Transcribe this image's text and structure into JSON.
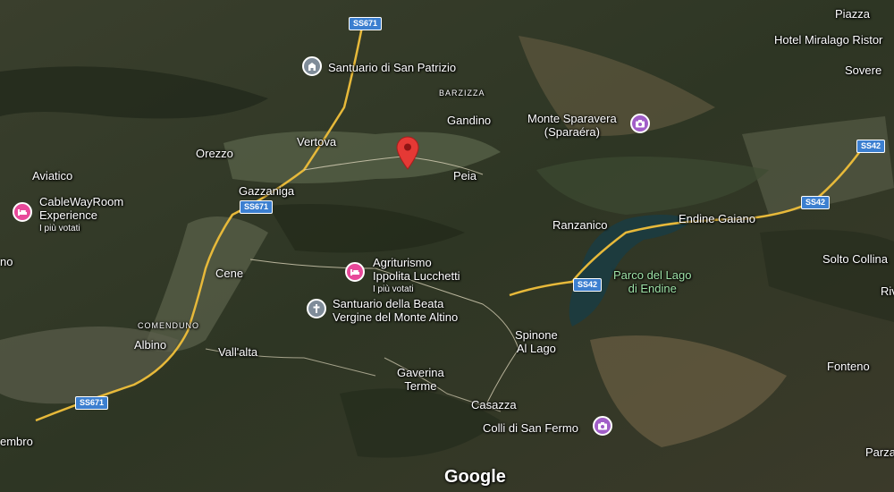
{
  "map": {
    "places": {
      "piazza": "Piazza",
      "hotel": "Hotel Miralago Ristor",
      "sovere": "Sovere",
      "barzizza": "BARZIZZA",
      "gandino": "Gandino",
      "vertova": "Vertova",
      "orezzo": "Orezzo",
      "aviatico": "Aviatico",
      "gazzaniga": "Gazzaniga",
      "peia": "Peia",
      "ranzanico": "Ranzanico",
      "endine": "Endine Gaiano",
      "solto": "Solto Collina",
      "riva": "Riv",
      "cene": "Cene",
      "comenduno": "COMENDUNO",
      "albino": "Albino",
      "vallalta": "Vall'alta",
      "spinone_1": "Spinone",
      "spinone_2": "Al Lago",
      "gaverina_1": "Gaverina",
      "gaverina_2": "Terme",
      "casazza": "Casazza",
      "fonteno": "Fonteno",
      "nembro": "embro",
      "parzanica": "Parza",
      "no": "no"
    },
    "park": {
      "line1": "Parco del Lago",
      "line2": "di Endine"
    },
    "pois": {
      "san_patrizio": "Santuario di San Patrizio",
      "sparavera_1": "Monte Sparavera",
      "sparavera_2": "(Sparaéra)",
      "cableway_1": "CableWayRoom",
      "cableway_2": "Experience",
      "cableway_sub": "I più votati",
      "agriturismo_1": "Agriturismo",
      "agriturismo_2": "Ippolita Lucchetti",
      "agriturismo_sub": "I più votati",
      "altino_1": "Santuario della Beata",
      "altino_2": "Vergine del Monte Altino",
      "san_fermo": "Colli di San Fermo"
    },
    "roads": {
      "ss671_top": "SS671",
      "ss671_mid": "SS671",
      "ss671_bottom": "SS671",
      "ss42_a": "SS42",
      "ss42_b": "SS42",
      "ss42_c": "SS42"
    },
    "logo": "Google",
    "colors": {
      "road": "#e7b93a",
      "lake": "#1d3b3e",
      "poi_hotel": "#e8499a",
      "poi_attraction": "#a15ec8",
      "poi_church": "#7f8c99",
      "pin": "#e53935",
      "shield": "#3c7fd0",
      "park_label": "#9fe3a8"
    },
    "icons": [
      "bed-icon",
      "camera-icon",
      "church-icon",
      "cross-icon",
      "map-pin-icon"
    ]
  }
}
